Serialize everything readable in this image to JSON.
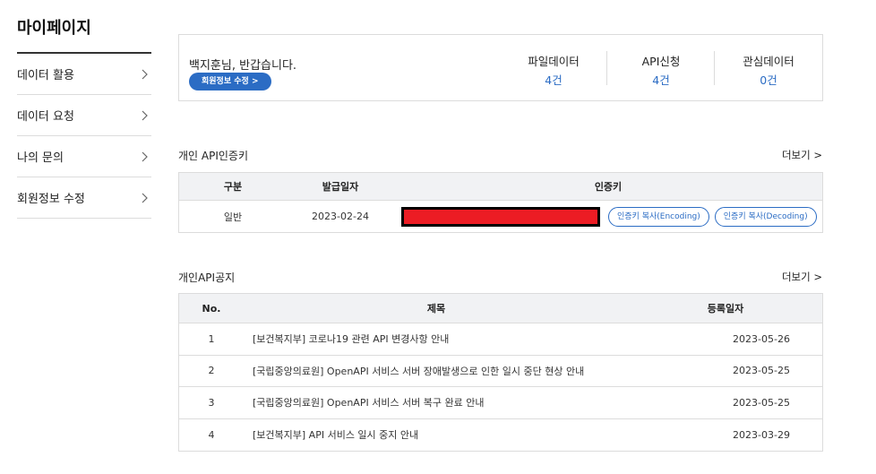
{
  "sidebar": {
    "title": "마이페이지",
    "items": [
      {
        "label": "데이터 활용"
      },
      {
        "label": "데이터 요청"
      },
      {
        "label": "나의 문의"
      },
      {
        "label": "회원정보 수정"
      }
    ]
  },
  "summary": {
    "greeting": "백지훈님, 반갑습니다.",
    "edit_label": "회원정보 수정 >",
    "stats": [
      {
        "label": "파일데이터",
        "value": "4건"
      },
      {
        "label": "API신청",
        "value": "4건"
      },
      {
        "label": "관심데이터",
        "value": "0건"
      }
    ]
  },
  "api_keys": {
    "title": "개인 API인증키",
    "more": "더보기 >",
    "headers": [
      "구분",
      "발급일자",
      "인증키"
    ],
    "row": {
      "type": "일반",
      "date": "2023-02-24",
      "copy_encoding": "인증키 복사(Encoding)",
      "copy_decoding": "인증키 복사(Decoding)"
    }
  },
  "notices": {
    "title": "개인API공지",
    "more": "더보기 >",
    "headers": [
      "No.",
      "제목",
      "등록일자"
    ],
    "rows": [
      {
        "no": "1",
        "title": "[보건복지부] 코로나19 관련 API 변경사항 안내",
        "date": "2023-05-26"
      },
      {
        "no": "2",
        "title": "[국립중앙의료원] OpenAPI 서비스 서버 장애발생으로 인한 일시 중단 현상 안내",
        "date": "2023-05-25"
      },
      {
        "no": "3",
        "title": "[국립중앙의료원] OpenAPI 서비스 서버 복구 완료 안내",
        "date": "2023-05-25"
      },
      {
        "no": "4",
        "title": "[보건복지부] API 서비스 일시 중지 안내",
        "date": "2023-03-29"
      }
    ]
  },
  "colors": {
    "accent": "#2b6cc4",
    "redaction": "#ec1c24"
  }
}
